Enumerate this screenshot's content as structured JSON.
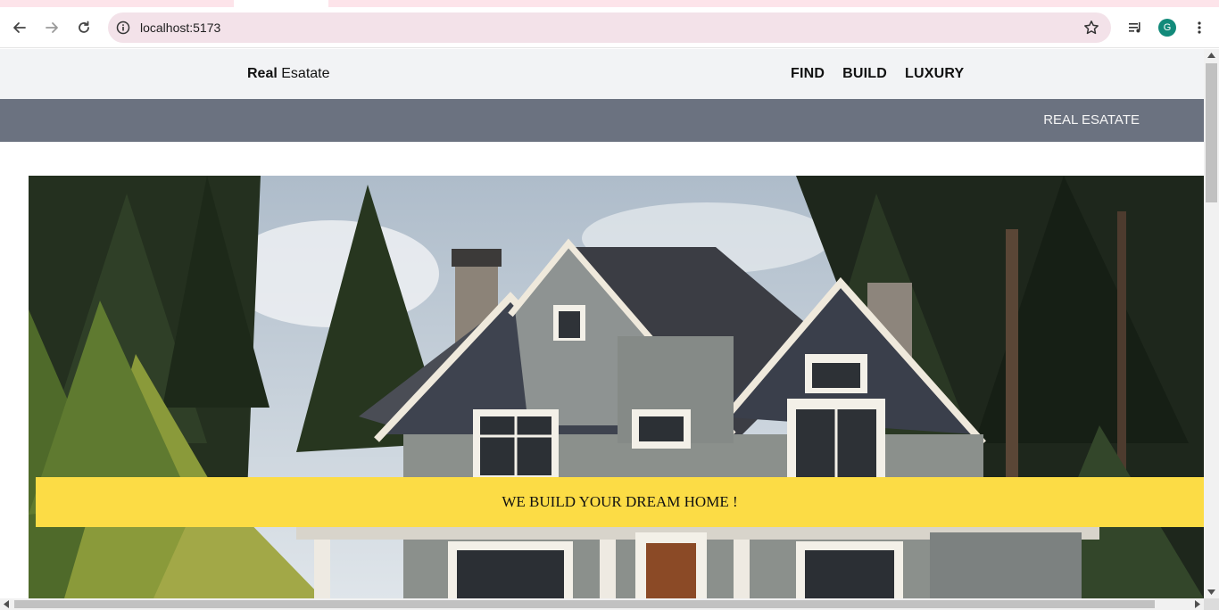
{
  "browser": {
    "url": "localhost:5173",
    "profile_initial": "G",
    "icons": [
      "back-icon",
      "forward-icon",
      "reload-icon",
      "site-info-icon",
      "bookmark-star-icon",
      "media-controls-icon",
      "profile-avatar",
      "more-menu-icon"
    ],
    "colors": {
      "tabstrip": "#fde4ea",
      "omnibox": "#f3e2e9",
      "avatar": "#128a7a"
    }
  },
  "navbar": {
    "brand_bold": "Real",
    "brand_rest": "Esatate",
    "links": [
      "FIND",
      "BUILD",
      "LUXURY"
    ]
  },
  "subbar": {
    "title": "REAL ESATATE",
    "color": "#6b7280"
  },
  "hero": {
    "image_subject": "two-story grey house with white trim surrounded by pine trees",
    "banner_text": "WE BUILD YOUR DREAM HOME !",
    "banner_color": "#fcdc45"
  }
}
